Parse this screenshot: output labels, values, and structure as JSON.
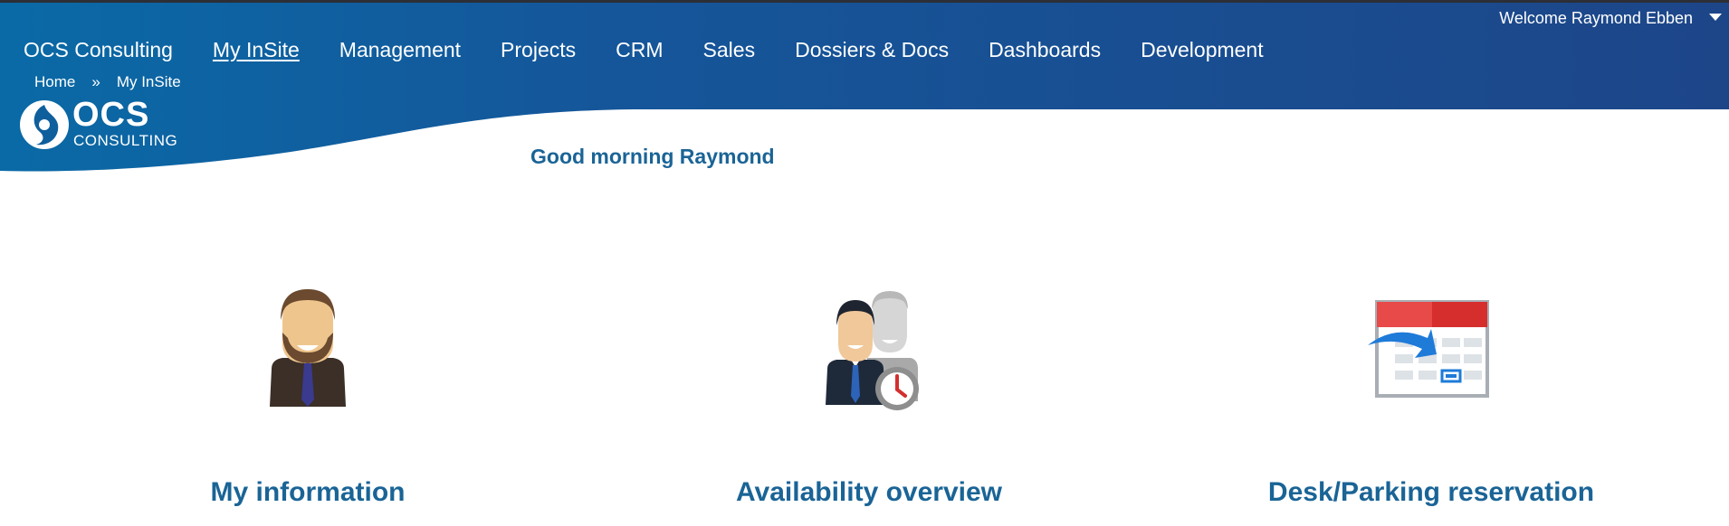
{
  "header": {
    "welcome_text": "Welcome Raymond Ebben",
    "nav": [
      {
        "label": "OCS Consulting"
      },
      {
        "label": "My InSite"
      },
      {
        "label": "Management"
      },
      {
        "label": "Projects"
      },
      {
        "label": "CRM"
      },
      {
        "label": "Sales"
      },
      {
        "label": "Dossiers & Docs"
      },
      {
        "label": "Dashboards"
      },
      {
        "label": "Development"
      }
    ],
    "active_nav": "My InSite",
    "breadcrumb": {
      "home": "Home",
      "separator": "»",
      "current": "My InSite"
    },
    "logo": {
      "big": "OCS",
      "small": "CONSULTING"
    },
    "colors": {
      "header_dark": "#1d4689",
      "header_light": "#0a6aa6",
      "accent_text": "#1a6496"
    }
  },
  "main": {
    "greeting": "Good morning Raymond",
    "tiles": [
      {
        "label": "My information",
        "icon": "businessman-icon"
      },
      {
        "label": "Availability overview",
        "icon": "availability-clock-icon"
      },
      {
        "label": "Desk/Parking reservation",
        "icon": "calendar-reservation-icon"
      }
    ]
  }
}
